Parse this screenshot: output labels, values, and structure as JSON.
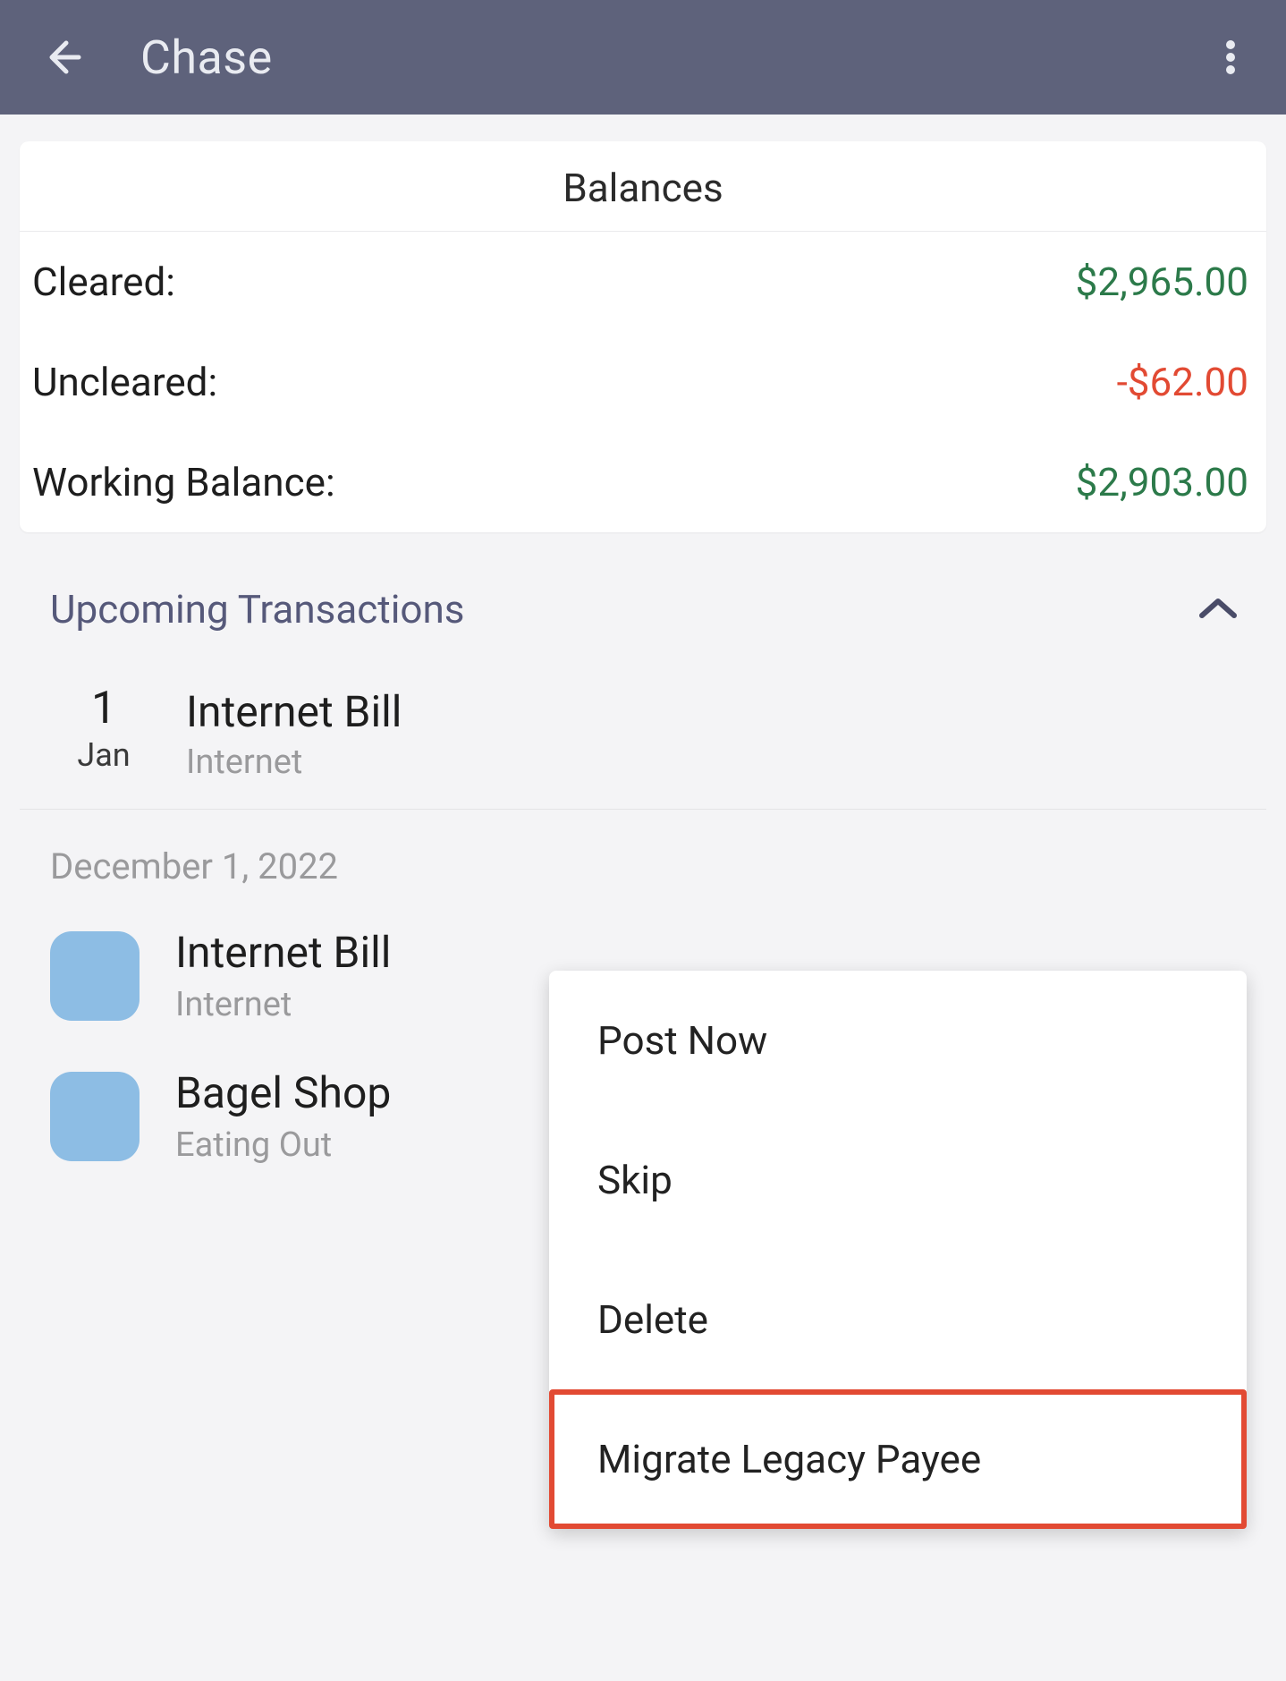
{
  "header": {
    "title": "Chase"
  },
  "balances": {
    "title": "Balances",
    "rows": [
      {
        "label": "Cleared:",
        "amount": "$2,965.00",
        "tone": "green"
      },
      {
        "label": "Uncleared:",
        "amount": "-$62.00",
        "tone": "red"
      },
      {
        "label": "Working Balance:",
        "amount": "$2,903.00",
        "tone": "green"
      }
    ]
  },
  "upcoming": {
    "title": "Upcoming Transactions",
    "items": [
      {
        "day": "1",
        "month": "Jan",
        "payee": "Internet Bill",
        "category": "Internet"
      }
    ]
  },
  "groups": [
    {
      "date": "December 1, 2022",
      "transactions": [
        {
          "payee": "Internet Bill",
          "category": "Internet"
        },
        {
          "payee": "Bagel Shop",
          "category": "Eating Out"
        }
      ]
    }
  ],
  "context_menu": {
    "items": [
      {
        "label": "Post Now",
        "highlight": false
      },
      {
        "label": "Skip",
        "highlight": false
      },
      {
        "label": "Delete",
        "highlight": false
      },
      {
        "label": "Migrate Legacy Payee",
        "highlight": true
      }
    ]
  }
}
